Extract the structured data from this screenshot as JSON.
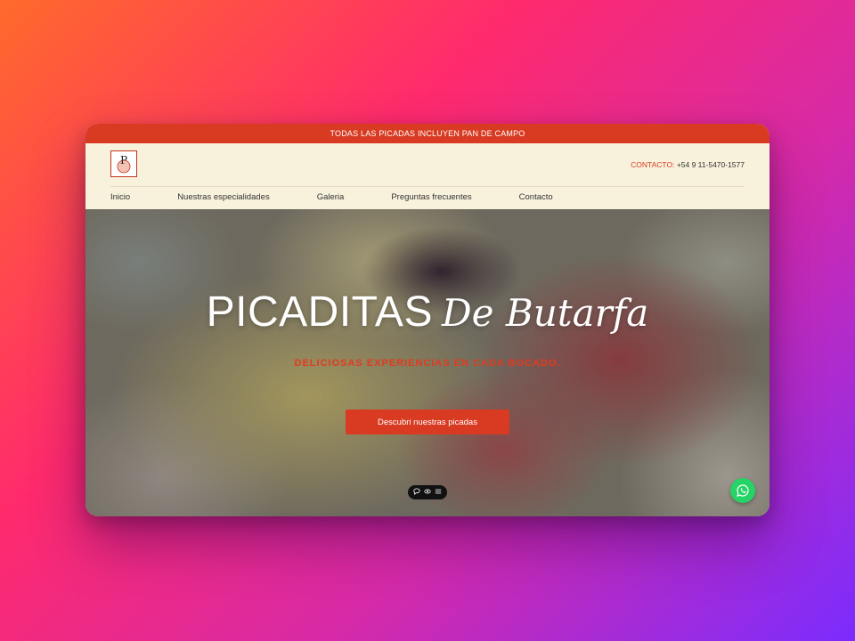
{
  "announcement": "TODAS LAS PICADAS INCLUYEN PAN DE CAMPO",
  "header": {
    "logo_letter": "P",
    "contact_label": "CONTACTO:",
    "contact_phone": "+54 9 11-5470-1577"
  },
  "nav": {
    "items": [
      "Inicio",
      "Nuestras especialidades",
      "Galeria",
      "Preguntas frecuentes",
      "Contacto"
    ]
  },
  "hero": {
    "title_main": "PICADITAS",
    "title_script": "De Butarfa",
    "subtitle": "DELICIOSAS EXPERIENCIAS EN CADA BOCADO.",
    "cta_label": "Descubri nuestras picadas"
  },
  "colors": {
    "accent": "#d83a22",
    "cream": "#f8f2dc",
    "whatsapp": "#25d366"
  },
  "icons": [
    "chat-bubble-icon",
    "eye-icon",
    "menu-icon",
    "whatsapp-icon"
  ]
}
